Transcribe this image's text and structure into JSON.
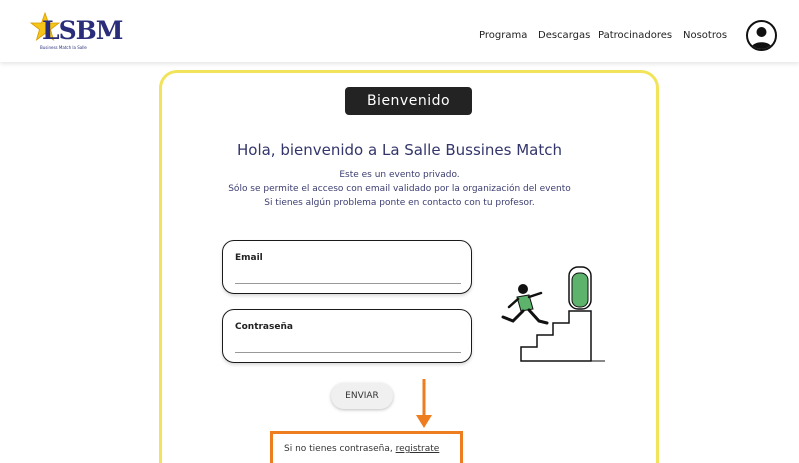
{
  "header": {
    "logo_text": "LSBM",
    "logo_subtitle": "Business Match la Salle",
    "nav": [
      "Programa",
      "Descargas",
      "Patrocinadores",
      "Nosotros"
    ]
  },
  "main": {
    "badge": "Bienvenido",
    "greeting": "Hola, bienvenido a La Salle Bussines Match",
    "info_lines": [
      "Este es un evento privado.",
      "Sólo se permite el acceso con email validado por la organización del evento",
      "Si tienes algún problema ponte en contacto con tu profesor."
    ],
    "email_label": "Email",
    "email_value": "",
    "password_label": "Contraseña",
    "password_value": "",
    "submit_label": "ENVIAR",
    "register_prefix": "Si no tienes contraseña, ",
    "register_link": "registrate"
  },
  "colors": {
    "card_border": "#f1e45a",
    "highlight": "#ee7d1f",
    "brand": "#2a2d7a"
  },
  "icons": {
    "logo": "star-logo-icon",
    "avatar": "user-avatar-icon",
    "arrow": "arrow-down-icon",
    "illustration": "person-climbing-stairs-illustration"
  }
}
